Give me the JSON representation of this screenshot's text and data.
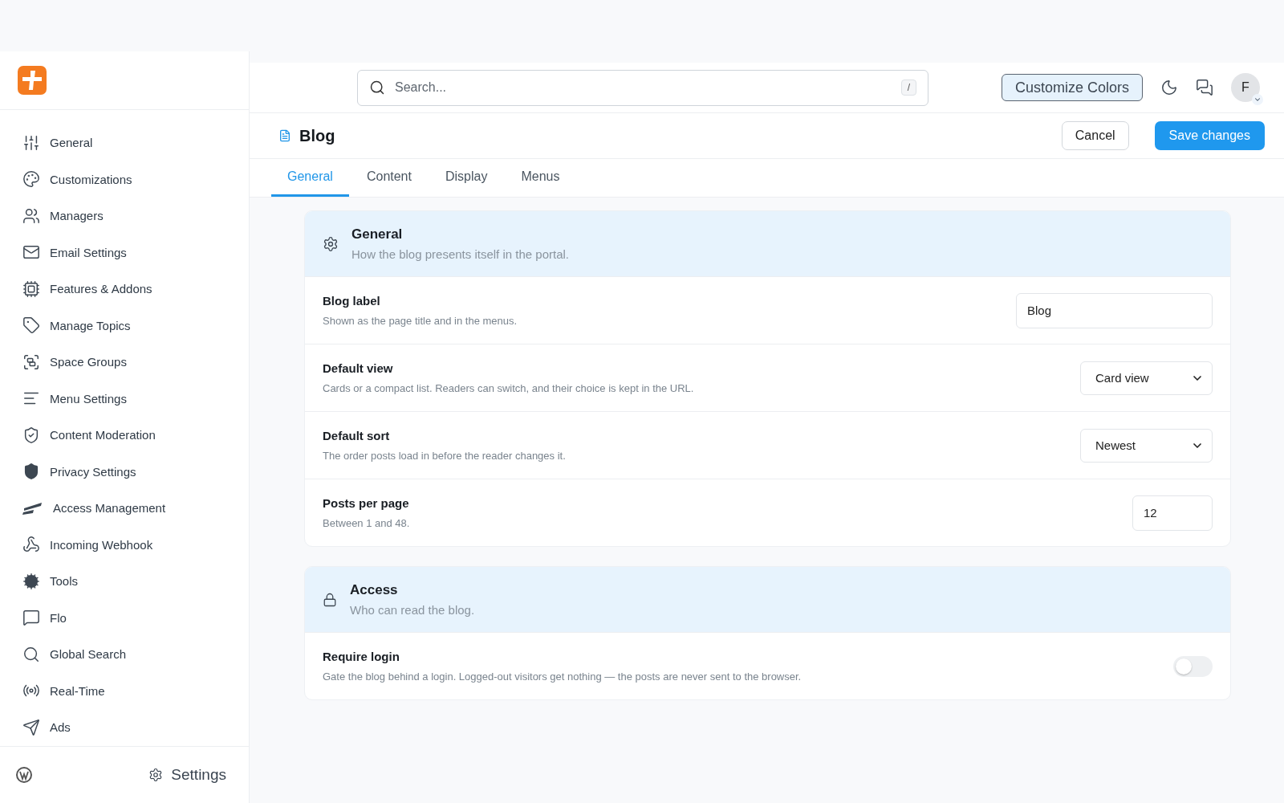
{
  "sidebar": {
    "items": [
      {
        "label": "General",
        "selected": false
      },
      {
        "label": "Customizations",
        "selected": false
      },
      {
        "label": "Managers",
        "selected": false
      },
      {
        "label": "Email Settings",
        "selected": false
      },
      {
        "label": "Features & Addons",
        "selected": false
      },
      {
        "label": "Manage Topics",
        "selected": false
      },
      {
        "label": "Space Groups",
        "selected": false
      },
      {
        "label": "Menu Settings",
        "selected": false
      },
      {
        "label": "Content Moderation",
        "selected": false
      },
      {
        "label": "Privacy Settings",
        "selected": false
      },
      {
        "label": "Access Management",
        "selected": false
      },
      {
        "label": "Incoming Webhook",
        "selected": false
      },
      {
        "label": "Tools",
        "selected": false
      },
      {
        "label": "Flo",
        "selected": false
      },
      {
        "label": "Global Search",
        "selected": false
      },
      {
        "label": "Real-Time",
        "selected": false
      },
      {
        "label": "Ads",
        "selected": false
      }
    ],
    "footer": {
      "settings": "Settings"
    }
  },
  "topbar": {
    "search": {
      "placeholder": "Search...",
      "shortcut": "/"
    },
    "customize_button": "Customize Colors",
    "avatar": "F"
  },
  "page": {
    "title": "Blog",
    "cancel": "Cancel",
    "save": "Save changes"
  },
  "tabs": [
    {
      "label": "General",
      "selected": true
    },
    {
      "label": "Content",
      "selected": false
    },
    {
      "label": "Display",
      "selected": false
    },
    {
      "label": "Menus",
      "selected": false
    }
  ],
  "sections": [
    {
      "kind": "general",
      "title": "General",
      "subtitle": "How the blog presents itself in the portal.",
      "rows": [
        {
          "kind": "text",
          "label": "Blog label",
          "description": "Shown as the page title and in the menus.",
          "value": "Blog"
        },
        {
          "kind": "select",
          "label": "Default view",
          "description": "Cards or a compact list. Readers can switch, and their choice is kept in the URL.",
          "value": "Card view"
        },
        {
          "kind": "select",
          "label": "Default sort",
          "description": "The order posts load in before the reader changes it.",
          "value": "Newest"
        },
        {
          "kind": "number",
          "label": "Posts per page",
          "description": "Between 1 and 48.",
          "value": "12"
        }
      ]
    },
    {
      "kind": "access",
      "title": "Access",
      "subtitle": "Who can read the blog.",
      "rows": [
        {
          "kind": "toggle",
          "label": "Require login",
          "description": "Gate the blog behind a login. Logged-out visitors get nothing — the posts are never sent to the browser.",
          "on": false
        }
      ]
    }
  ]
}
